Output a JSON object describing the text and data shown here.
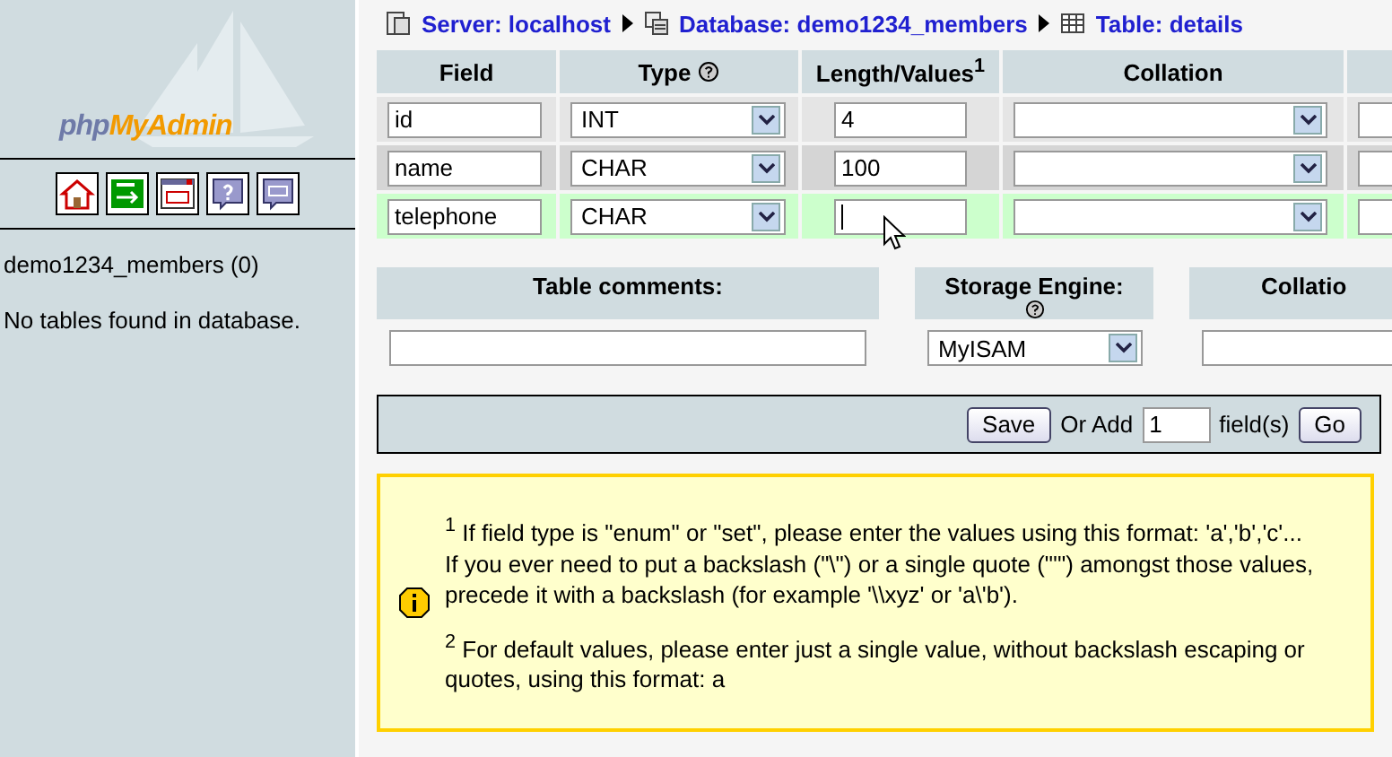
{
  "sidebar": {
    "logo": {
      "first": "php",
      "second": "MyAdmin"
    },
    "database": "demo1234_members (0)",
    "message": "No tables found in database."
  },
  "breadcrumb": [
    "Server: localhost",
    "Database: demo1234_members",
    "Table: details"
  ],
  "columns": [
    {
      "label": "Field",
      "help": false
    },
    {
      "label": "Type",
      "help": true
    },
    {
      "label": "Length/Values$^{1}$",
      "help": false
    },
    {
      "label": "Collation",
      "help": false
    }
  ],
  "rows": [
    {
      "field": "id",
      "type": "INT",
      "length": "4",
      "highlighted": false,
      "focused": false
    },
    {
      "field": "name",
      "type": "CHAR",
      "length": "100",
      "highlighted": false,
      "focused": false
    },
    {
      "field": "telephone",
      "type": "CHAR",
      "length": "",
      "highlighted": true,
      "focused": true
    }
  ],
  "table_options": {
    "comments_label": "Table comments:",
    "engine_label": "Storage Engine:",
    "engine": "MyISAM",
    "collation_label": "Collatio"
  },
  "footer": {
    "save": "Save",
    "or_add": "Or Add",
    "count": "1",
    "fields": "field(s)",
    "go": "Go"
  },
  "notes": [
    {
      "lines": [
        "$^{1}$ If field type is \"enum\" or \"set\", please enter the values using this format: 'a','b','c'...",
        "If you ever need to put a backslash (\"\\\") or a single quote (\"'\") amongst those values, precede it with a backslash (for example '\\\\xyz' or 'a\\'b')."
      ]
    },
    {
      "lines": [
        "$^{2}$ For default values, please enter just a single value, without backslash escaping or quotes, using this format: a"
      ]
    }
  ]
}
